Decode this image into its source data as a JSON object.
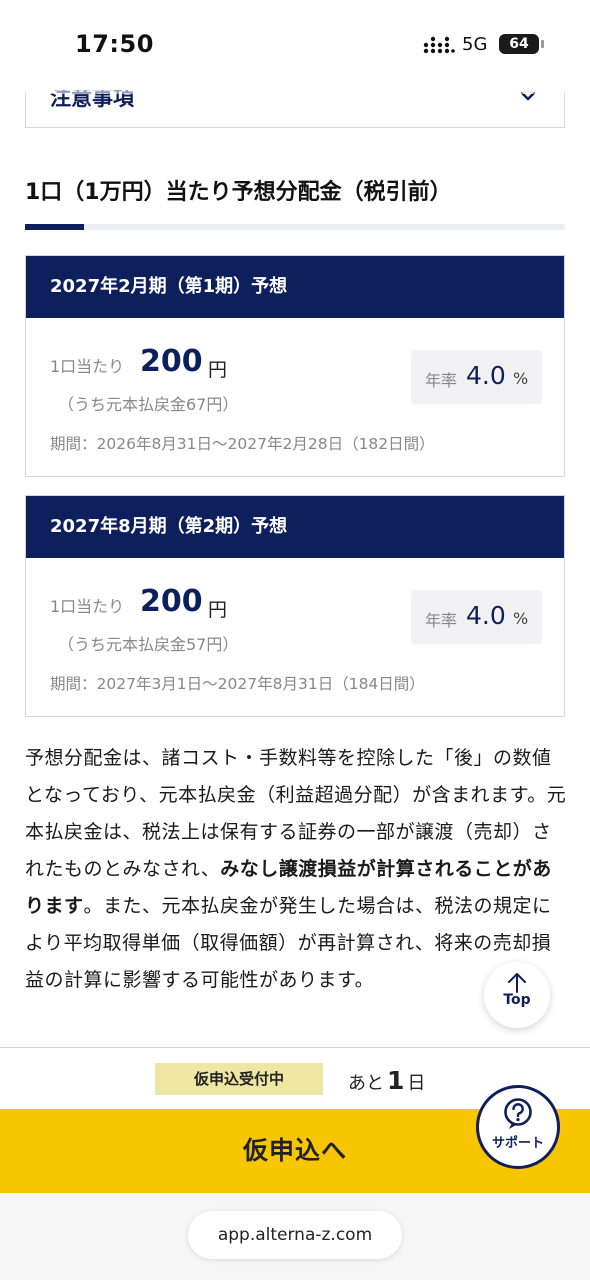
{
  "status_bar": {
    "time": "17:50",
    "network": "5G",
    "battery": "64"
  },
  "notes": {
    "title": "注意事項"
  },
  "section": {
    "title": "1口（1万円）当たり予想分配金（税引前）"
  },
  "cards": [
    {
      "header": "2027年2月期（第1期）予想",
      "per_unit_label": "1口当たり",
      "amount": "200",
      "currency": "円",
      "return_of_capital": "（うち元本払戻金67円）",
      "rate_label": "年率",
      "rate_value": "4.0",
      "rate_unit": "%",
      "period": "期間：2026年8月31日～2027年2月28日（182日間）"
    },
    {
      "header": "2027年8月期（第2期）予想",
      "per_unit_label": "1口当たり",
      "amount": "200",
      "currency": "円",
      "return_of_capital": "（うち元本払戻金57円）",
      "rate_label": "年率",
      "rate_value": "4.0",
      "rate_unit": "%",
      "period": "期間：2027年3月1日～2027年8月31日（184日間）"
    }
  ],
  "disclaimer": {
    "part1": "予想分配金は、諸コスト・手数料等を控除した「後」の数値となっており、元本払戻金（利益超過分配）が含まれます。元本払戻金は、税法上は保有する証券の一部が譲渡（売却）されたものとみなされ、",
    "bold": "みなし譲渡損益が計算されることがあります",
    "part2": "。また、元本払戻金が発生した場合は、税法の規定により平均取得単価（取得価額）が再計算され、将来の売却損益の計算に影響する可能性があります。"
  },
  "top_button": {
    "label": "Top"
  },
  "apply_bar": {
    "badge": "仮申込受付中",
    "remaining_prefix": "あと",
    "remaining_days": "1",
    "remaining_suffix": "日",
    "button_label": "仮申込へ"
  },
  "support_button": {
    "label": "サポート"
  },
  "browser": {
    "url": "app.alterna-z.com"
  },
  "colors": {
    "navy": "#0d1f5c",
    "accent_yellow": "#f7c600",
    "badge_bg": "#efe6a4"
  }
}
